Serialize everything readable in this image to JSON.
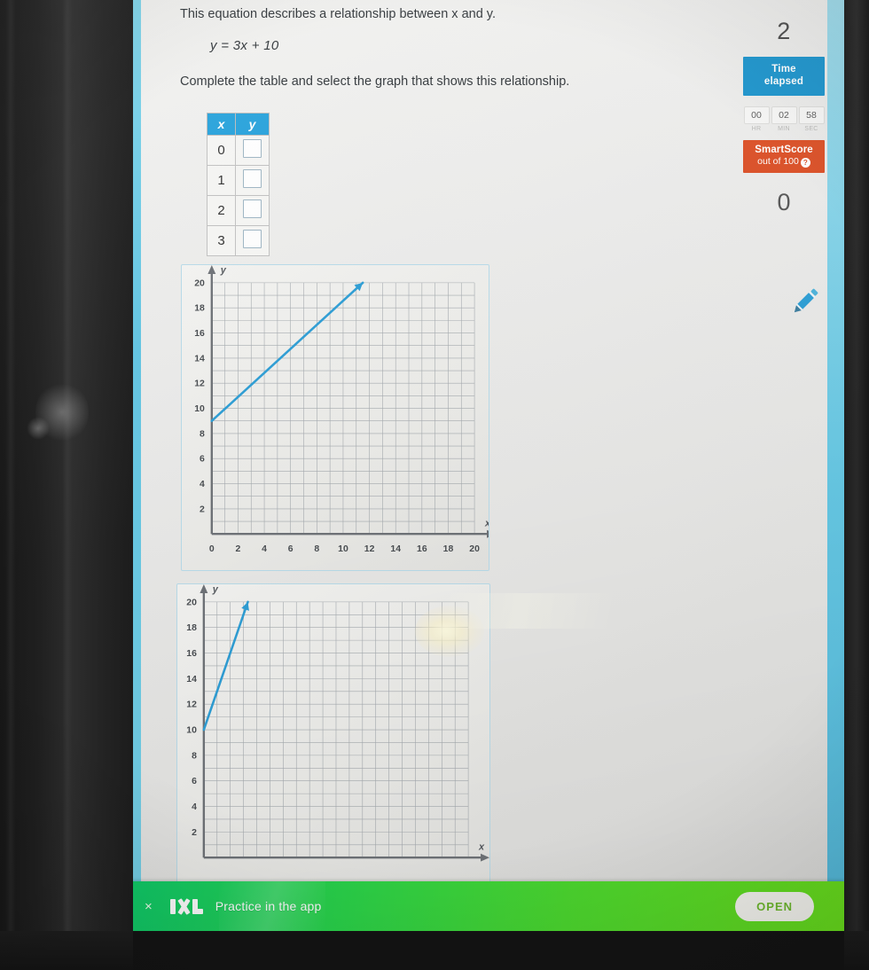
{
  "question": {
    "prompt": "This equation describes a relationship between x and y.",
    "equation": "y = 3x + 10",
    "instruction": "Complete the table and select the graph that shows this relationship."
  },
  "table": {
    "headers": [
      "x",
      "y"
    ],
    "rows": [
      {
        "x": "0",
        "y": ""
      },
      {
        "x": "1",
        "y": ""
      },
      {
        "x": "2",
        "y": ""
      },
      {
        "x": "3",
        "y": ""
      }
    ]
  },
  "sidebar": {
    "question_number": "2",
    "time_banner_line1": "Time",
    "time_banner_line2": "elapsed",
    "timer": {
      "hours": "00",
      "minutes": "02",
      "seconds": "58",
      "hours_label": "HR",
      "minutes_label": "MIN",
      "seconds_label": "SEC"
    },
    "smartscore_title": "SmartScore",
    "smartscore_subtitle": "out of 100",
    "smartscore_help_icon": "?",
    "smartscore_value": "0"
  },
  "pencil_icon": "pencil-icon",
  "appbar": {
    "close_icon": "×",
    "logo_text": "IXL",
    "promo_text": "Practice in the app",
    "open_label": "OPEN"
  },
  "colors": {
    "header_blue": "#29a3dc",
    "time_banner_blue": "#1e96ce",
    "smartscore_orange": "#dc5128",
    "line_blue": "#2f9fd6",
    "axis_gray": "#6f7378",
    "grid_gray": "#9aa0a6",
    "appbar_green_start": "#0ec96b",
    "appbar_green_end": "#6ae01d"
  },
  "chart_data": [
    {
      "id": "choice-1",
      "type": "line",
      "title": "",
      "xlabel": "x",
      "ylabel": "y",
      "xlim": [
        0,
        20
      ],
      "ylim": [
        0,
        20
      ],
      "xticks": [
        0,
        2,
        4,
        6,
        8,
        10,
        12,
        14,
        16,
        18,
        20
      ],
      "yticks": [
        2,
        4,
        6,
        8,
        10,
        12,
        14,
        16,
        18,
        20
      ],
      "grid": true,
      "grid_step": 1,
      "series": [
        {
          "name": "line-a",
          "points": [
            [
              0,
              9
            ],
            [
              11.5,
              20
            ]
          ],
          "slope": 1,
          "intercept": 9,
          "arrow_end": true,
          "color": "#2f9fd6"
        }
      ]
    },
    {
      "id": "choice-2",
      "type": "line",
      "title": "",
      "xlabel": "x",
      "ylabel": "y",
      "xlim": [
        0,
        20
      ],
      "ylim": [
        0,
        20
      ],
      "xticks": [],
      "yticks": [
        2,
        4,
        6,
        8,
        10,
        12,
        14,
        16,
        18,
        20
      ],
      "grid": true,
      "grid_step": 1,
      "series": [
        {
          "name": "line-b",
          "points": [
            [
              0,
              10
            ],
            [
              3.33,
              20
            ]
          ],
          "slope": 3,
          "intercept": 10,
          "arrow_end": true,
          "color": "#2f9fd6"
        }
      ]
    }
  ]
}
